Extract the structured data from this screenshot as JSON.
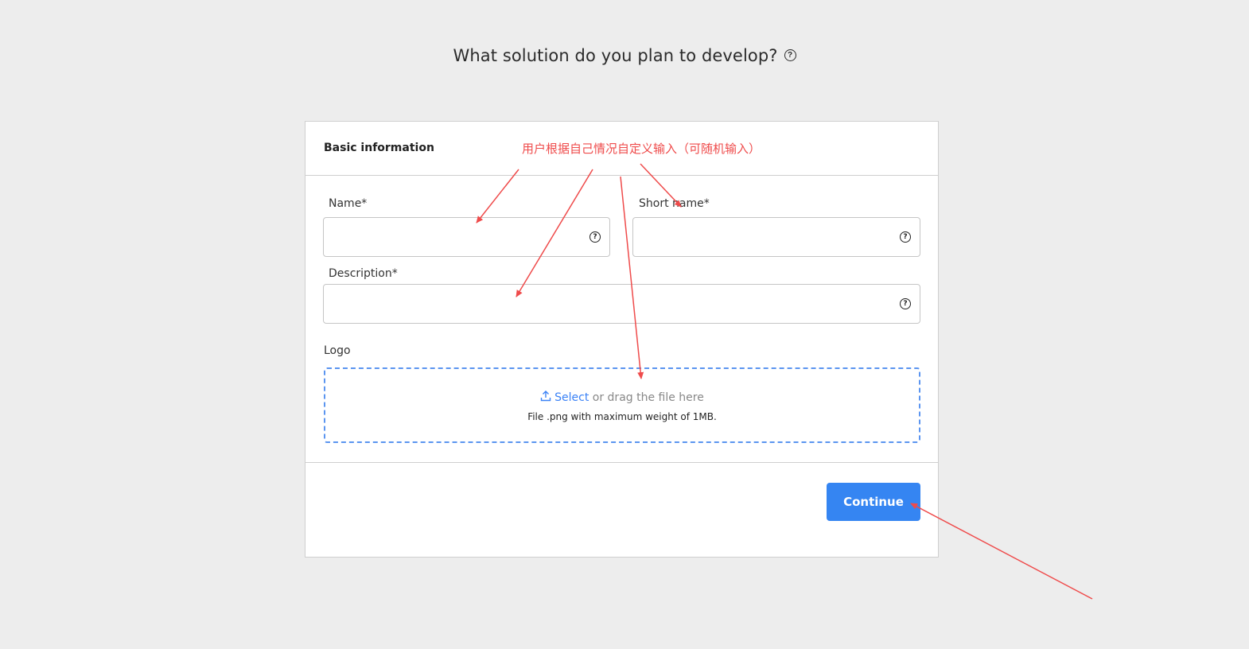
{
  "page": {
    "title": "What solution do you plan to develop?",
    "title_help_icon": "question-circle-icon"
  },
  "card": {
    "section_title": "Basic information",
    "annotation": "用户根据自己情况自定义输入（可随机输入）",
    "annotation_color": "#ef4b4b",
    "fields": {
      "name": {
        "label": "Name*",
        "value": "",
        "icon": "question-circle-icon"
      },
      "short_name": {
        "label": "Short name*",
        "value": "",
        "icon": "question-circle-icon"
      },
      "description": {
        "label": "Description*",
        "value": "",
        "icon": "question-circle-icon"
      }
    },
    "logo": {
      "label": "Logo",
      "upload_icon": "upload-icon",
      "select_text": "Select",
      "drag_text": " or drag the file here",
      "hint": "File .png with maximum weight of 1MB."
    },
    "continue_label": "Continue",
    "accent_color": "#3585f2"
  }
}
